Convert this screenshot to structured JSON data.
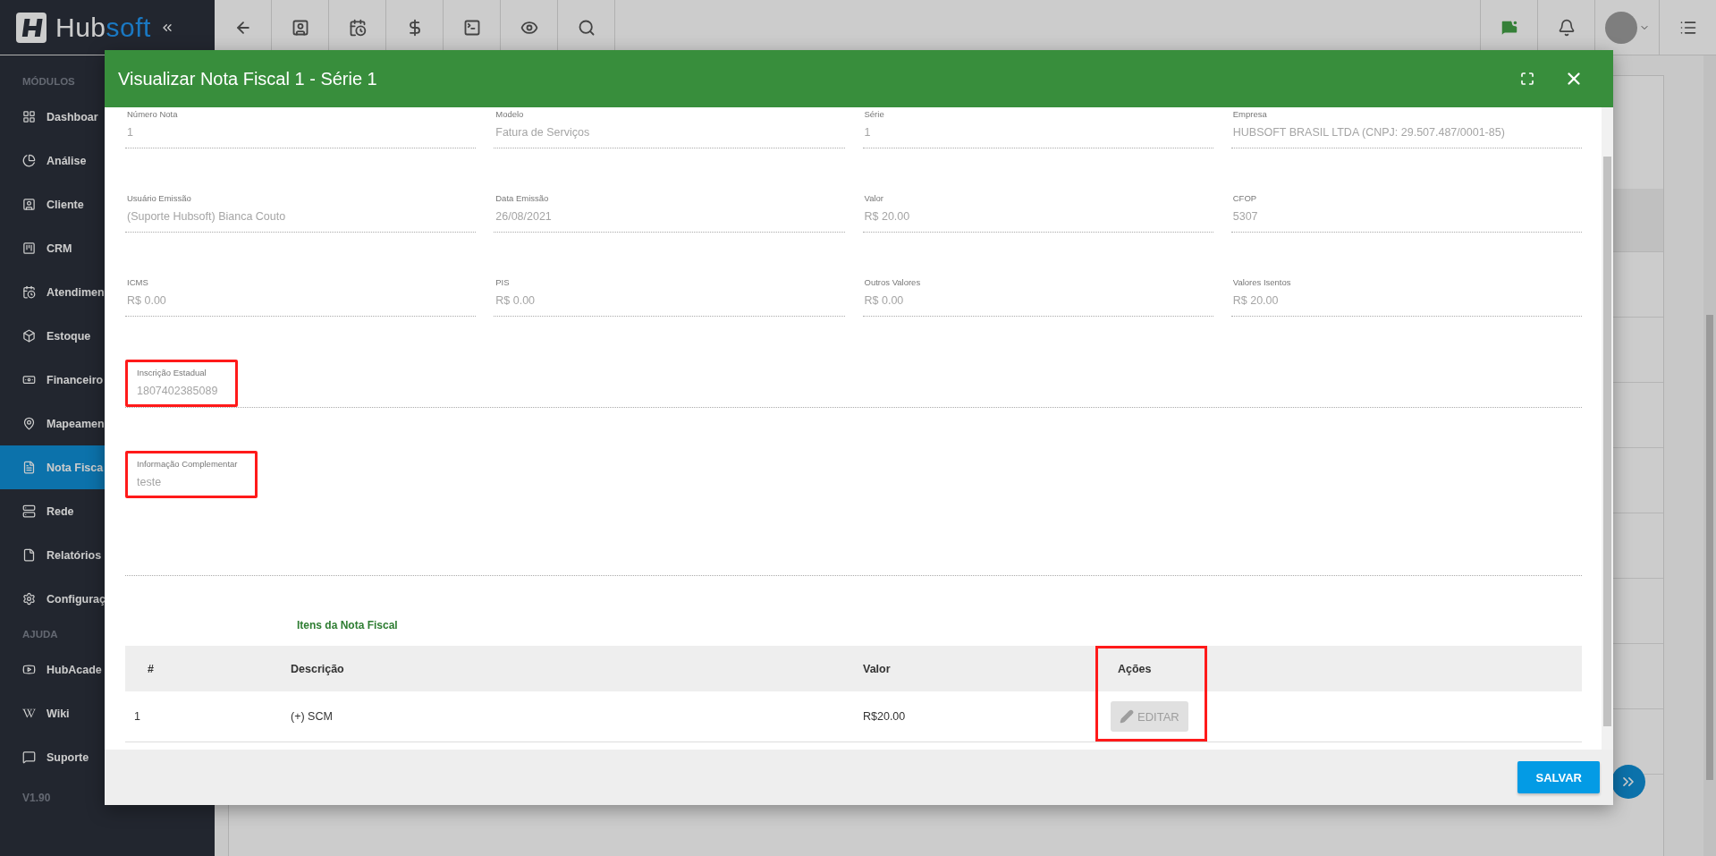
{
  "logo": {
    "first": "Hub",
    "second": "soft"
  },
  "sidebar": {
    "sections": [
      {
        "title": "MÓDULOS",
        "items": [
          {
            "label": "Dashboar",
            "selected": false
          },
          {
            "label": "Análise",
            "selected": false
          },
          {
            "label": "Cliente",
            "selected": false
          },
          {
            "label": "CRM",
            "selected": false
          },
          {
            "label": "Atendimen",
            "selected": false
          },
          {
            "label": "Estoque",
            "selected": false
          },
          {
            "label": "Financeiro",
            "selected": false
          },
          {
            "label": "Mapeamen",
            "selected": false
          },
          {
            "label": "Nota Fisca",
            "selected": true
          },
          {
            "label": "Rede",
            "selected": false
          },
          {
            "label": "Relatórios",
            "selected": false
          },
          {
            "label": "Configuraç",
            "selected": false
          }
        ]
      },
      {
        "title": "AJUDA",
        "items": [
          {
            "label": "HubAcade",
            "selected": false
          },
          {
            "label": "Wiki",
            "selected": false
          },
          {
            "label": "Suporte",
            "selected": false
          }
        ]
      }
    ],
    "version": "V1.90"
  },
  "modal": {
    "title": "Visualizar Nota Fiscal 1 - Série 1",
    "field_rows": [
      [
        {
          "label": "Número Nota",
          "value": "1",
          "highlighted": false
        },
        {
          "label": "Modelo",
          "value": "Fatura de Serviços",
          "highlighted": false
        },
        {
          "label": "Série",
          "value": "1",
          "highlighted": false
        },
        {
          "label": "Empresa",
          "value": "HUBSOFT BRASIL LTDA (CNPJ: 29.507.487/0001-85)",
          "highlighted": false
        }
      ],
      [
        {
          "label": "Usuário Emissão",
          "value": "(Suporte Hubsoft) Bianca Couto",
          "highlighted": false
        },
        {
          "label": "Data Emissão",
          "value": "26/08/2021",
          "highlighted": false
        },
        {
          "label": "Valor",
          "value": "R$ 20.00",
          "highlighted": false
        },
        {
          "label": "CFOP",
          "value": "5307",
          "highlighted": false
        }
      ],
      [
        {
          "label": "ICMS",
          "value": "R$ 0.00",
          "highlighted": false
        },
        {
          "label": "PIS",
          "value": "R$ 0.00",
          "highlighted": false
        },
        {
          "label": "Outros Valores",
          "value": "R$ 0.00",
          "highlighted": false
        },
        {
          "label": "Valores Isentos",
          "value": "R$ 20.00",
          "highlighted": false
        }
      ],
      [
        {
          "label": "Inscrição Estadual",
          "value": "1807402385089",
          "highlighted": true,
          "kind": "input"
        }
      ],
      [
        {
          "label": "Informação Complementar",
          "value": "teste",
          "highlighted": true,
          "kind": "textarea"
        }
      ]
    ],
    "items_title": "Itens da Nota Fiscal",
    "table": {
      "columns": [
        {
          "label": "#",
          "highlighted": false
        },
        {
          "label": "Descrição",
          "highlighted": false
        },
        {
          "label": "Valor",
          "highlighted": false
        },
        {
          "label": "Ações",
          "highlighted": true
        }
      ],
      "rows": [
        {
          "cells": [
            "1",
            "(+) SCM",
            "R$20.00"
          ],
          "action": {
            "label": "EDITAR",
            "disabled": true
          }
        }
      ]
    },
    "save_button": "SALVAR"
  }
}
